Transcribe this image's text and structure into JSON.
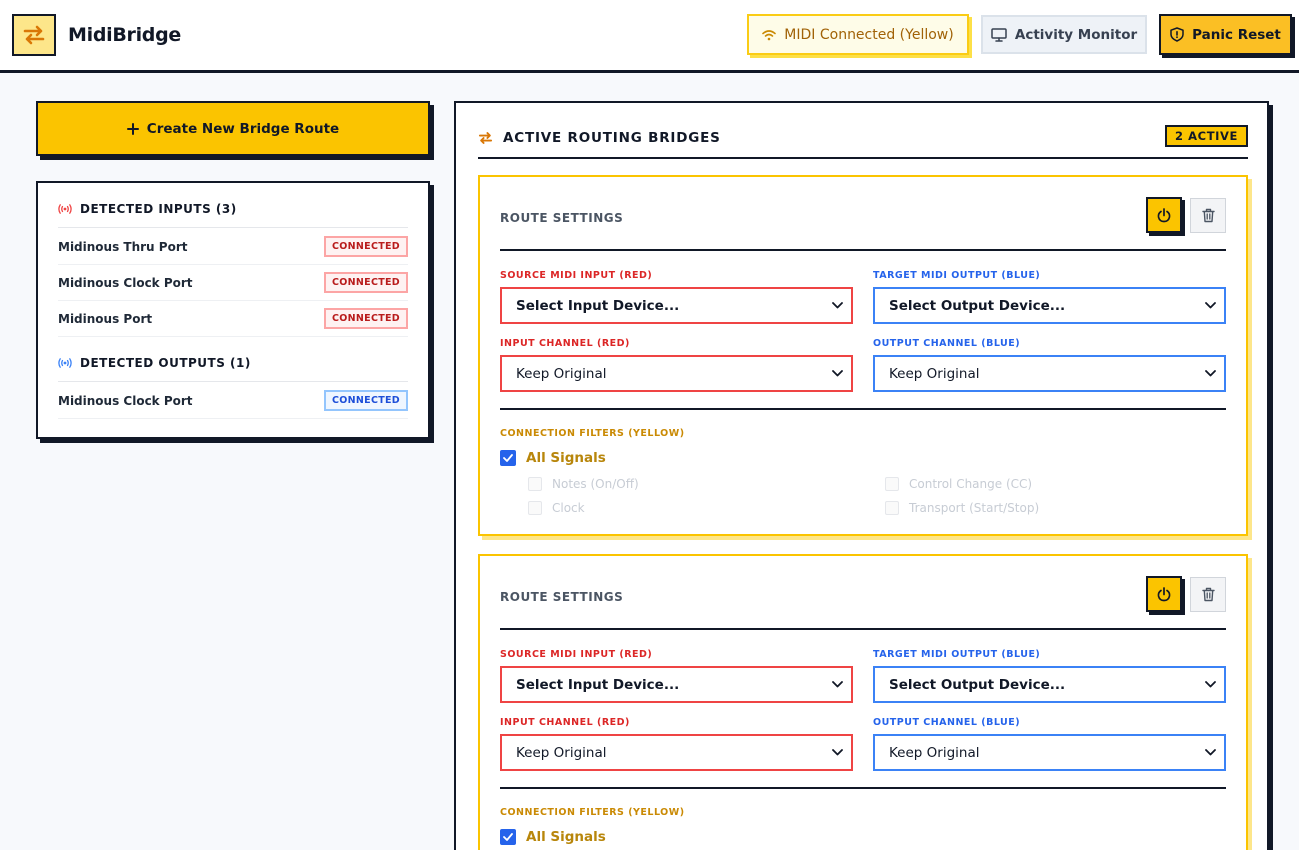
{
  "header": {
    "app_title": "MidiBridge",
    "midi_status": "MIDI Connected (Yellow)",
    "activity_label": "Activity Monitor",
    "panic_label": "Panic Reset"
  },
  "sidebar": {
    "create_label": "Create New Bridge Route",
    "inputs_title": "DETECTED INPUTS (3)",
    "inputs": [
      {
        "name": "Midinous Thru Port",
        "status": "CONNECTED"
      },
      {
        "name": "Midinous Clock Port",
        "status": "CONNECTED"
      },
      {
        "name": "Midinous Port",
        "status": "CONNECTED"
      }
    ],
    "outputs_title": "DETECTED OUTPUTS (1)",
    "outputs": [
      {
        "name": "Midinous Clock Port",
        "status": "CONNECTED"
      }
    ]
  },
  "main": {
    "title": "ACTIVE ROUTING BRIDGES",
    "active_badge": "2 ACTIVE",
    "routes": [
      {
        "title": "ROUTE SETTINGS",
        "source_label": "SOURCE MIDI INPUT (RED)",
        "source_value": "Select Input Device...",
        "target_label": "TARGET MIDI OUTPUT (BLUE)",
        "target_value": "Select Output Device...",
        "in_ch_label": "INPUT CHANNEL (RED)",
        "in_ch_value": "Keep Original",
        "out_ch_label": "OUTPUT CHANNEL (BLUE)",
        "out_ch_value": "Keep Original",
        "filters_label": "CONNECTION FILTERS (YELLOW)",
        "all_signals": "All Signals",
        "filters": [
          "Notes (On/Off)",
          "Control Change (CC)",
          "Clock",
          "Transport (Start/Stop)"
        ]
      },
      {
        "title": "ROUTE SETTINGS",
        "source_label": "SOURCE MIDI INPUT (RED)",
        "source_value": "Select Input Device...",
        "target_label": "TARGET MIDI OUTPUT (BLUE)",
        "target_value": "Select Output Device...",
        "in_ch_label": "INPUT CHANNEL (RED)",
        "in_ch_value": "Keep Original",
        "out_ch_label": "OUTPUT CHANNEL (BLUE)",
        "out_ch_value": "Keep Original",
        "filters_label": "CONNECTION FILTERS (YELLOW)",
        "all_signals": "All Signals"
      }
    ]
  },
  "icons": {
    "logo": "swap-arrows-icon",
    "wifi": "wifi-icon",
    "monitor": "monitor-icon",
    "shield": "shield-alert-icon",
    "plus": "plus-icon",
    "input_radio": "radio-signal-icon",
    "output_radio": "radio-signal-icon",
    "power": "power-icon",
    "trash": "trash-icon",
    "chevron": "chevron-down-icon",
    "check": "check-icon"
  },
  "colors": {
    "accent_yellow": "#fbc400",
    "input_red": "#ef4444",
    "output_blue": "#3b82f6",
    "ink": "#111827"
  }
}
